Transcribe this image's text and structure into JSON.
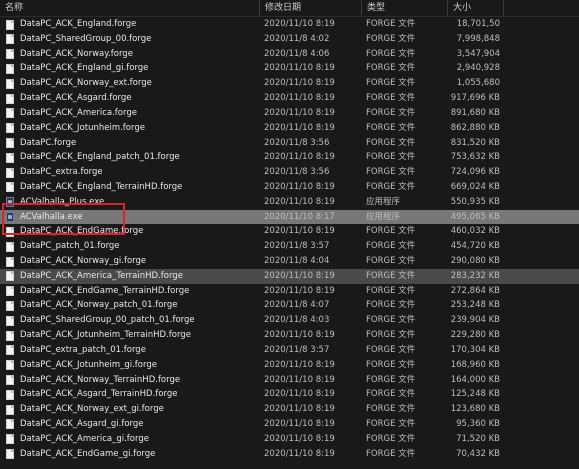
{
  "header": {
    "name": "名称",
    "date": "修改日期",
    "type": "类型",
    "size": "大小"
  },
  "colors": {
    "background": "#191919",
    "selected_row": "#777777",
    "highlight_box": "#d6252b"
  },
  "files": [
    {
      "name": "DataPC_ACK_England.forge",
      "date": "2020/11/10 8:19",
      "type": "FORGE 文件",
      "size": "18,701,50",
      "icon": "file-icon",
      "state": ""
    },
    {
      "name": "DataPC_SharedGroup_00.forge",
      "date": "2020/11/8 4:02",
      "type": "FORGE 文件",
      "size": "7,998,848",
      "icon": "file-icon",
      "state": ""
    },
    {
      "name": "DataPC_ACK_Norway.forge",
      "date": "2020/11/8 4:06",
      "type": "FORGE 文件",
      "size": "3,547,904",
      "icon": "file-icon",
      "state": ""
    },
    {
      "name": "DataPC_ACK_England_gi.forge",
      "date": "2020/11/10 8:19",
      "type": "FORGE 文件",
      "size": "2,940,928",
      "icon": "file-icon",
      "state": ""
    },
    {
      "name": "DataPC_ACK_Norway_ext.forge",
      "date": "2020/11/10 8:19",
      "type": "FORGE 文件",
      "size": "1,055,680",
      "icon": "file-icon",
      "state": ""
    },
    {
      "name": "DataPC_ACK_Asgard.forge",
      "date": "2020/11/10 8:19",
      "type": "FORGE 文件",
      "size": "917,696 KB",
      "icon": "file-icon",
      "state": ""
    },
    {
      "name": "DataPC_ACK_America.forge",
      "date": "2020/11/10 8:19",
      "type": "FORGE 文件",
      "size": "891,680 KB",
      "icon": "file-icon",
      "state": ""
    },
    {
      "name": "DataPC_ACK_Jotunheim.forge",
      "date": "2020/11/10 8:19",
      "type": "FORGE 文件",
      "size": "862,880 KB",
      "icon": "file-icon",
      "state": ""
    },
    {
      "name": "DataPC.forge",
      "date": "2020/11/8 3:56",
      "type": "FORGE 文件",
      "size": "831,520 KB",
      "icon": "file-icon",
      "state": ""
    },
    {
      "name": "DataPC_ACK_England_patch_01.forge",
      "date": "2020/11/10 8:19",
      "type": "FORGE 文件",
      "size": "753,632 KB",
      "icon": "file-icon",
      "state": ""
    },
    {
      "name": "DataPC_extra.forge",
      "date": "2020/11/8 3:56",
      "type": "FORGE 文件",
      "size": "724,096 KB",
      "icon": "file-icon",
      "state": ""
    },
    {
      "name": "DataPC_ACK_England_TerrainHD.forge",
      "date": "2020/11/10 8:19",
      "type": "FORGE 文件",
      "size": "669,024 KB",
      "icon": "file-icon",
      "state": ""
    },
    {
      "name": "ACValhalla_Plus.exe",
      "date": "2020/11/10 8:19",
      "type": "应用程序",
      "size": "550,935 KB",
      "icon": "exe-icon",
      "state": ""
    },
    {
      "name": "ACValhalla.exe",
      "date": "2020/11/10 8:17",
      "type": "应用程序",
      "size": "495,065 KB",
      "icon": "exe-icon",
      "state": "selected"
    },
    {
      "name": "DataPC_ACK_EndGame.forge",
      "date": "2020/11/10 8:19",
      "type": "FORGE 文件",
      "size": "460,032 KB",
      "icon": "file-icon",
      "state": ""
    },
    {
      "name": "DataPC_patch_01.forge",
      "date": "2020/11/8 3:57",
      "type": "FORGE 文件",
      "size": "454,720 KB",
      "icon": "file-icon",
      "state": ""
    },
    {
      "name": "DataPC_ACK_Norway_gi.forge",
      "date": "2020/11/8 4:04",
      "type": "FORGE 文件",
      "size": "290,080 KB",
      "icon": "file-icon",
      "state": ""
    },
    {
      "name": "DataPC_ACK_America_TerrainHD.forge",
      "date": "2020/11/10 8:19",
      "type": "FORGE 文件",
      "size": "283,232 KB",
      "icon": "file-icon",
      "state": "hover"
    },
    {
      "name": "DataPC_ACK_EndGame_TerrainHD.forge",
      "date": "2020/11/10 8:19",
      "type": "FORGE 文件",
      "size": "272,864 KB",
      "icon": "file-icon",
      "state": ""
    },
    {
      "name": "DataPC_ACK_Norway_patch_01.forge",
      "date": "2020/11/8 4:07",
      "type": "FORGE 文件",
      "size": "253,248 KB",
      "icon": "file-icon",
      "state": ""
    },
    {
      "name": "DataPC_SharedGroup_00_patch_01.forge",
      "date": "2020/11/8 4:03",
      "type": "FORGE 文件",
      "size": "239,904 KB",
      "icon": "file-icon",
      "state": ""
    },
    {
      "name": "DataPC_ACK_Jotunheim_TerrainHD.forge",
      "date": "2020/11/10 8:19",
      "type": "FORGE 文件",
      "size": "229,280 KB",
      "icon": "file-icon",
      "state": ""
    },
    {
      "name": "DataPC_extra_patch_01.forge",
      "date": "2020/11/8 3:57",
      "type": "FORGE 文件",
      "size": "170,304 KB",
      "icon": "file-icon",
      "state": ""
    },
    {
      "name": "DataPC_ACK_Jotunheim_gi.forge",
      "date": "2020/11/10 8:19",
      "type": "FORGE 文件",
      "size": "168,960 KB",
      "icon": "file-icon",
      "state": ""
    },
    {
      "name": "DataPC_ACK_Norway_TerrainHD.forge",
      "date": "2020/11/10 8:19",
      "type": "FORGE 文件",
      "size": "164,000 KB",
      "icon": "file-icon",
      "state": ""
    },
    {
      "name": "DataPC_ACK_Asgard_TerrainHD.forge",
      "date": "2020/11/10 8:19",
      "type": "FORGE 文件",
      "size": "125,248 KB",
      "icon": "file-icon",
      "state": ""
    },
    {
      "name": "DataPC_ACK_Norway_ext_gi.forge",
      "date": "2020/11/10 8:19",
      "type": "FORGE 文件",
      "size": "123,680 KB",
      "icon": "file-icon",
      "state": ""
    },
    {
      "name": "DataPC_ACK_Asgard_gi.forge",
      "date": "2020/11/10 8:19",
      "type": "FORGE 文件",
      "size": "95,360 KB",
      "icon": "file-icon",
      "state": ""
    },
    {
      "name": "DataPC_ACK_America_gi.forge",
      "date": "2020/11/10 8:19",
      "type": "FORGE 文件",
      "size": "71,520 KB",
      "icon": "file-icon",
      "state": ""
    },
    {
      "name": "DataPC_ACK_EndGame_gi.forge",
      "date": "2020/11/10 8:19",
      "type": "FORGE 文件",
      "size": "70,432 KB",
      "icon": "file-icon",
      "state": ""
    }
  ]
}
